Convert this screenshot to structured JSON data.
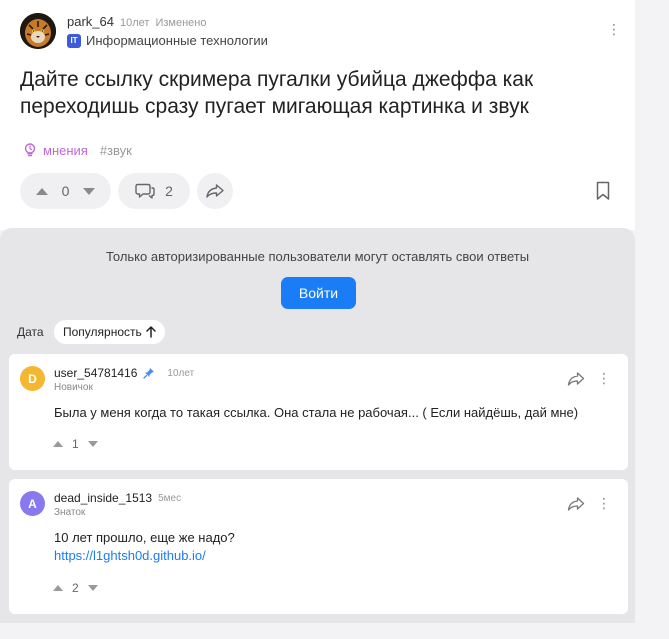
{
  "question": {
    "author": "park_64",
    "time": "10лет",
    "edited": "Изменено",
    "category": {
      "badge": "IT",
      "label": "Информационные технологии"
    },
    "title": "Дайте ссылку скримера пугалки убийца джеффа как переходишь сразу пугает мигающая картинка и звук",
    "tags": {
      "opinion": "мнения",
      "sound": "#звук"
    },
    "votes": "0",
    "comments": "2"
  },
  "answers_panel": {
    "notice": "Только авторизированные пользователи могут оставлять свои ответы",
    "login_label": "Войти",
    "sort": {
      "date": "Дата",
      "popularity": "Популярность"
    }
  },
  "answers": [
    {
      "avatar_letter": "D",
      "avatar_color": "#f4b731",
      "user": "user_54781416",
      "time": "10лет",
      "rank": "Новичок",
      "text": "Была у меня когда то такая ссылка. Она стала не рабочая... ( Если найдёшь, дай мне)",
      "votes": "1"
    },
    {
      "avatar_letter": "A",
      "avatar_color": "#8979ef",
      "user": "dead_inside_1513",
      "time": "5мес",
      "rank": "Знаток",
      "text": "10 лет прошло, еще же надо?",
      "link": "https://l1ghtsh0d.github.io/",
      "votes": "2"
    }
  ],
  "colors": {
    "accent": "#1a7cf7",
    "opinion_tag": "#c066dd",
    "panel_bg": "#e6e6e9"
  },
  "icons": [
    "tiger-avatar",
    "kebab-menu-icon",
    "bulb-icon",
    "chevron-up-icon",
    "chevron-down-icon",
    "comment-icon",
    "share-icon",
    "bookmark-icon",
    "pin-icon",
    "arrow-up-icon"
  ]
}
